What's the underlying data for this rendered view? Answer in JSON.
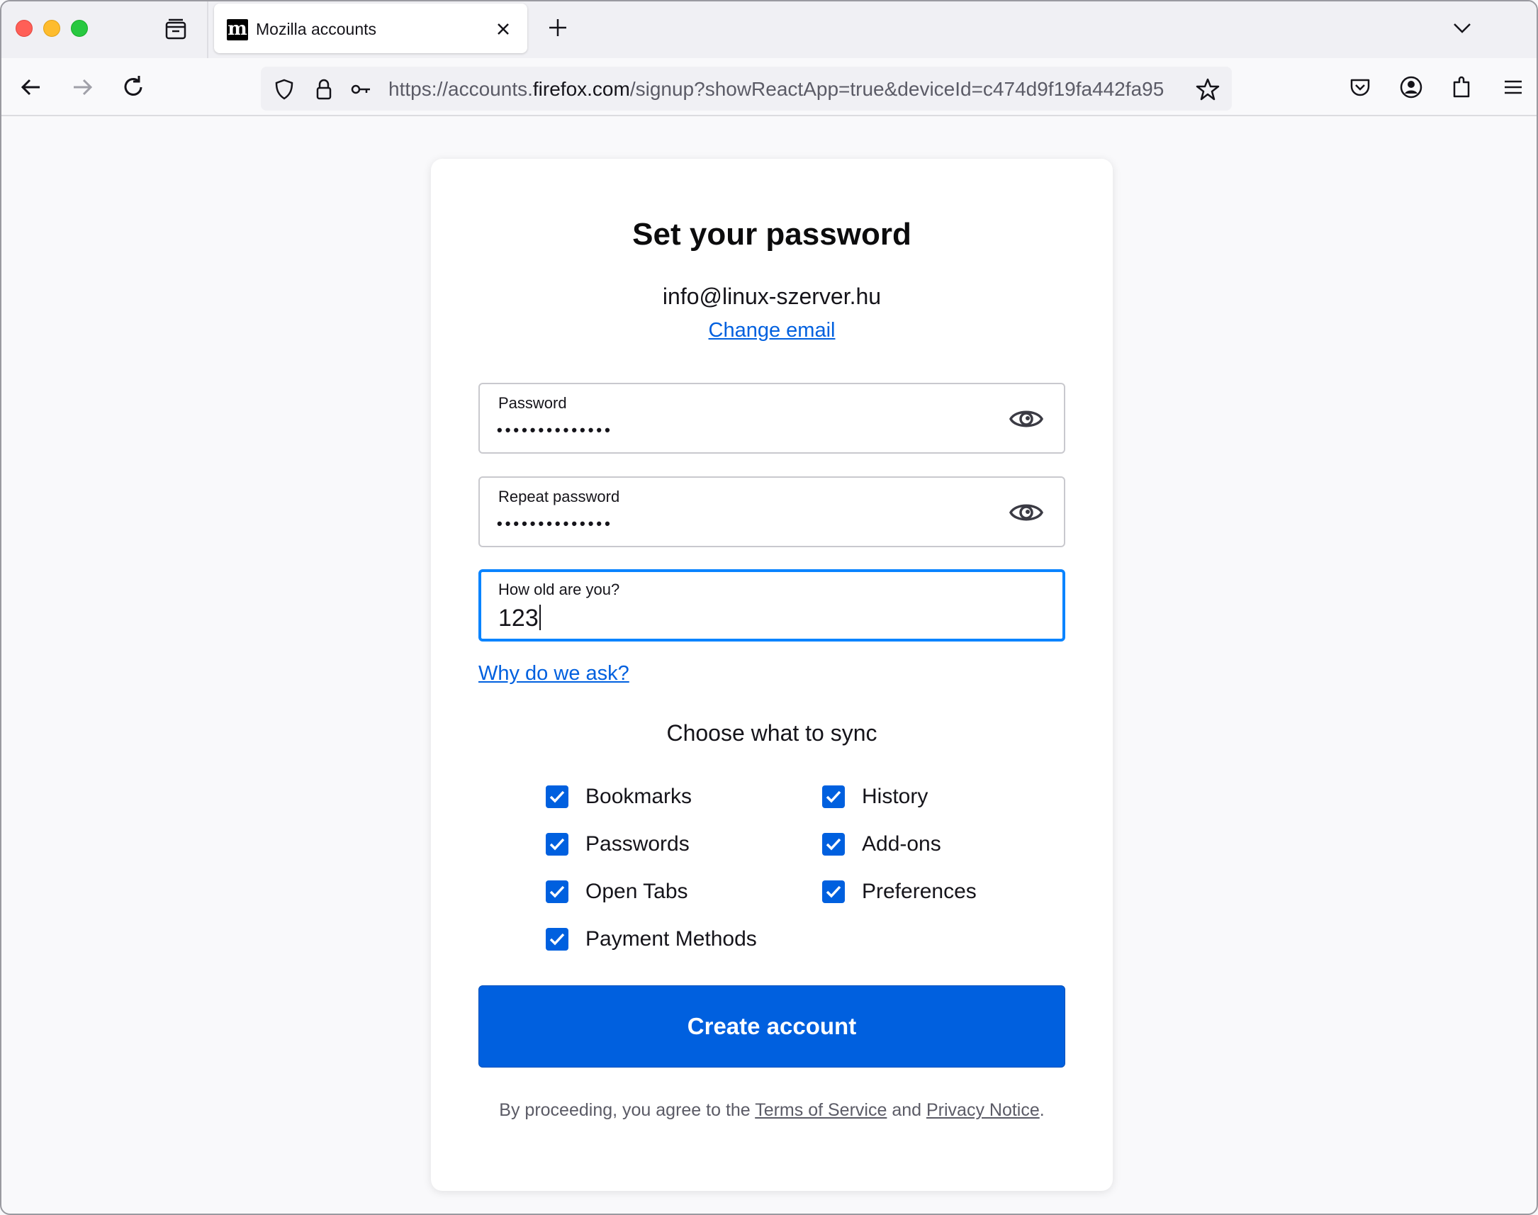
{
  "browser": {
    "tab": {
      "favicon_letter": "m",
      "title": "Mozilla accounts"
    },
    "url": {
      "prefix": "https://accounts.",
      "host": "firefox.com",
      "path": "/signup?showReactApp=true&deviceId=c474d9f19fa442fa95"
    },
    "icons": {
      "back": "back-arrow-icon",
      "forward": "forward-arrow-icon",
      "reload": "reload-icon",
      "shield": "shield-icon",
      "lock": "lock-icon",
      "key": "key-icon",
      "star": "star-icon",
      "pocket": "pocket-icon",
      "account": "account-icon",
      "extensions": "extensions-icon",
      "menu": "hamburger-menu-icon"
    }
  },
  "page": {
    "title": "Set your password",
    "email": "info@linux-szerver.hu",
    "change_email": "Change email",
    "fields": [
      {
        "label": "Password",
        "value": "••••••••••••••",
        "type": "password"
      },
      {
        "label": "Repeat password",
        "value": "••••••••••••••",
        "type": "password"
      },
      {
        "label": "How old are you?",
        "value": "123",
        "type": "number"
      }
    ],
    "why_link": "Why do we ask?",
    "sync_heading": "Choose what to sync",
    "sync_options": [
      {
        "label": "Bookmarks",
        "checked": true
      },
      {
        "label": "History",
        "checked": true
      },
      {
        "label": "Passwords",
        "checked": true
      },
      {
        "label": "Add-ons",
        "checked": true
      },
      {
        "label": "Open Tabs",
        "checked": true
      },
      {
        "label": "Preferences",
        "checked": true
      },
      {
        "label": "Payment Methods",
        "checked": true
      }
    ],
    "create_button": "Create account",
    "terms": {
      "prefix": "By proceeding, you agree to the ",
      "tos": "Terms of Service",
      "and": " and ",
      "privacy": "Privacy Notice",
      "suffix": "."
    }
  },
  "colors": {
    "accent": "#0060df",
    "focus": "#0a84ff",
    "background": "#f9f9fb"
  }
}
